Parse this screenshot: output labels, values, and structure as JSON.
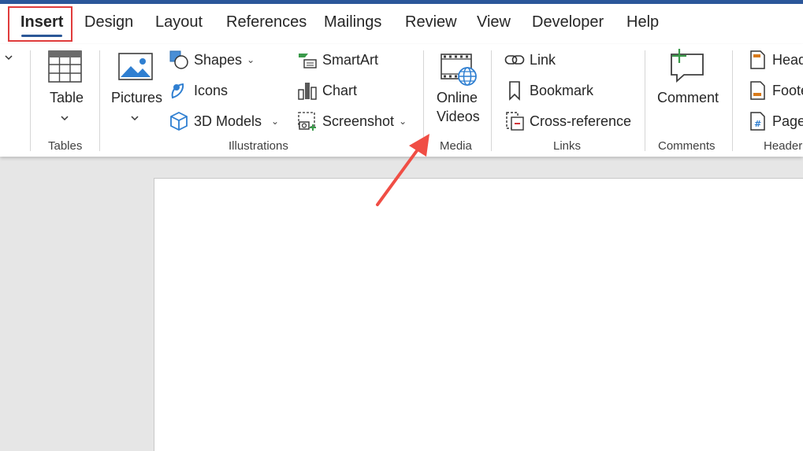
{
  "tabs": [
    "Insert",
    "Design",
    "Layout",
    "References",
    "Mailings",
    "Review",
    "View",
    "Developer",
    "Help"
  ],
  "active_tab": "Insert",
  "groups": {
    "tables": {
      "label": "Tables",
      "table_button": "Table"
    },
    "illustrations": {
      "label": "Illustrations",
      "pictures_button": "Pictures",
      "shapes": "Shapes",
      "icons": "Icons",
      "models_3d": "3D Models",
      "smartart": "SmartArt",
      "chart": "Chart",
      "screenshot": "Screenshot"
    },
    "media": {
      "label": "Media",
      "online_videos_line1": "Online",
      "online_videos_line2": "Videos"
    },
    "links": {
      "label": "Links",
      "link": "Link",
      "bookmark": "Bookmark",
      "cross_reference": "Cross-reference"
    },
    "comments": {
      "label": "Comments",
      "comment_button": "Comment"
    },
    "header_footer": {
      "label": "Header",
      "header": "Head",
      "footer": "Foote",
      "page_number": "Page"
    }
  },
  "colors": {
    "accent": "#2b579a",
    "highlight_box": "#e03c3c",
    "annotation_arrow": "#f04e45"
  },
  "icons": [
    "chevron-down-icon",
    "table-icon",
    "pictures-icon",
    "shapes-icon",
    "icons-icon",
    "3d-models-icon",
    "smartart-icon",
    "chart-icon",
    "screenshot-icon",
    "online-videos-icon",
    "link-icon",
    "bookmark-icon",
    "cross-reference-icon",
    "comment-icon",
    "header-icon",
    "footer-icon",
    "page-number-icon"
  ]
}
